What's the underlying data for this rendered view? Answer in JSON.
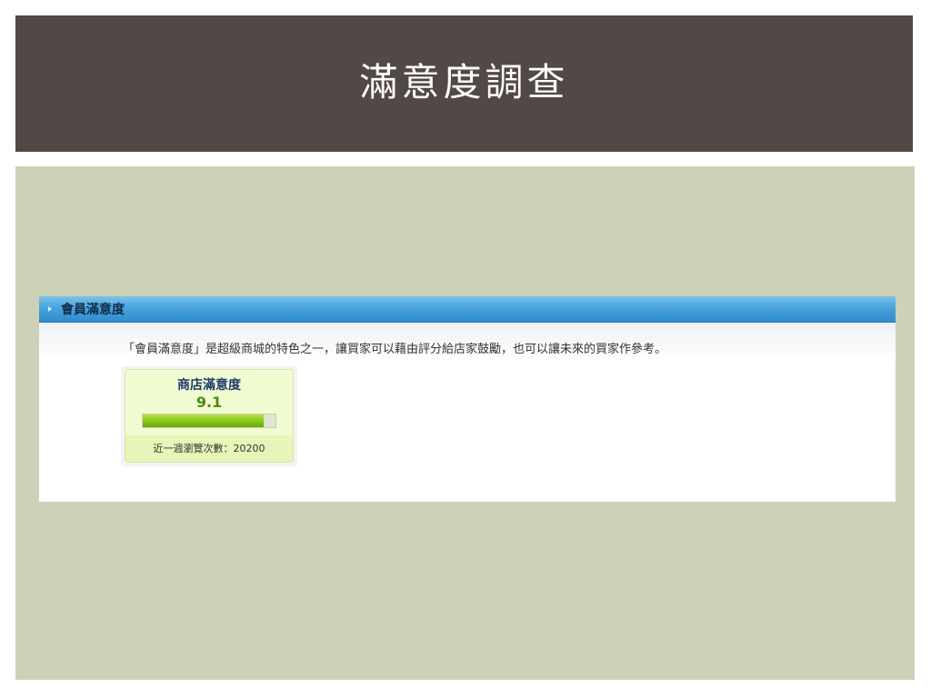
{
  "slide": {
    "title": "滿意度調查"
  },
  "panel": {
    "header_title": "會員滿意度",
    "description": "「會員滿意度」是超級商城的特色之一，讓買家可以藉由評分給店家鼓勵，也可以讓未來的買家作參考。"
  },
  "rating": {
    "title": "商店滿意度",
    "score": "9.1",
    "score_fraction": 0.91,
    "footer": "近一週瀏覽次數：20200"
  },
  "colors": {
    "title_bar": "#524846",
    "content_bg": "#cdd1b7",
    "panel_header": "#4aa3dc",
    "rating_bar_fill": "#8bc81b"
  },
  "icons": {
    "panel_header_icon": "triangle-right-icon"
  }
}
